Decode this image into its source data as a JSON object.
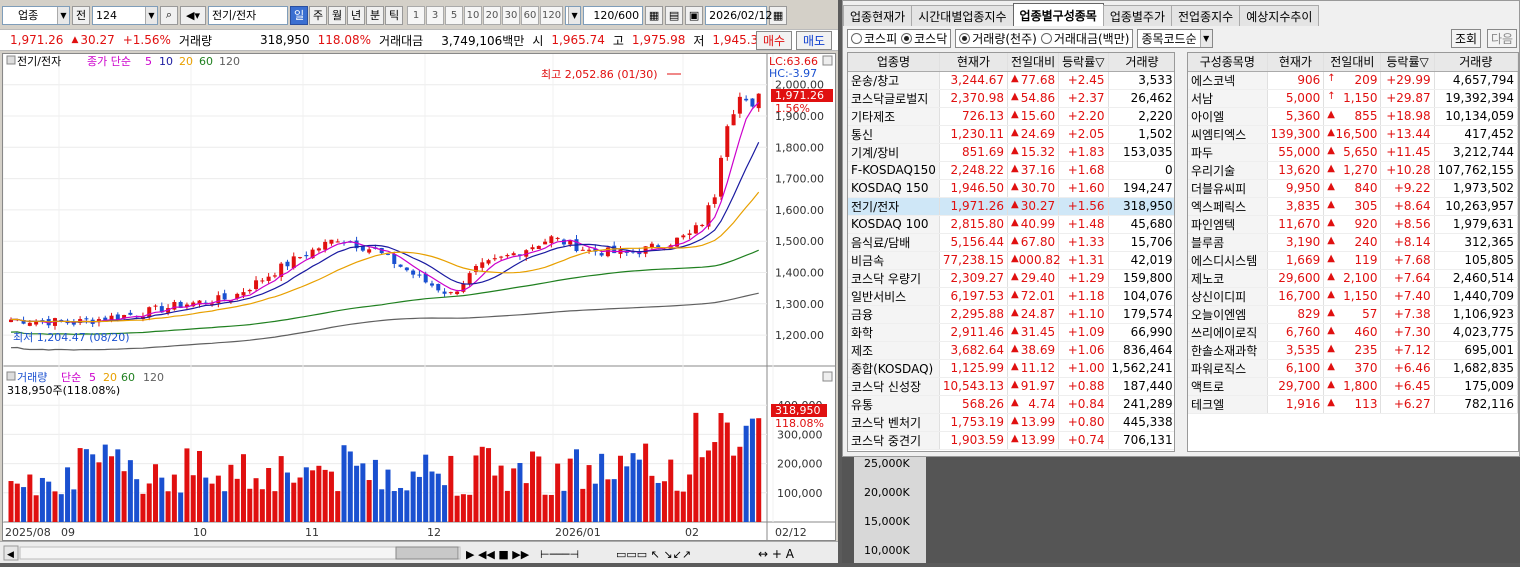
{
  "toolbar": {
    "sector_label": "업종",
    "prev_label": "전",
    "code": "124",
    "name": "전기/전자",
    "periods": [
      "일",
      "주",
      "월",
      "년",
      "분",
      "틱"
    ],
    "selected_period": "일",
    "nums": [
      "1",
      "3",
      "5",
      "10",
      "20",
      "30",
      "60",
      "120"
    ],
    "count": "120/600",
    "date": "2026/02/12"
  },
  "quote": {
    "price": "1,971.26",
    "arrow": "▲",
    "change": "30.27",
    "rate": "+1.56%",
    "vol_label": "거래량",
    "volume": "318,950",
    "vol_pct": "118.08%",
    "amt_label": "거래대금",
    "amount": "3,749,106백만",
    "open_label": "시",
    "open": "1,965.74",
    "high_label": "고",
    "high": "1,975.98",
    "low_label": "저",
    "low": "1,945.37",
    "buy": "매수",
    "sell": "매도"
  },
  "chart": {
    "legend_price": "전기/전자",
    "legend_ma_label": "종가 단순",
    "ma_periods": [
      "5",
      "10",
      "20",
      "60",
      "120"
    ],
    "lc": "LC:63.66",
    "hc": "HC:-3.97",
    "high_note": "최고 2,052.86 (01/30)",
    "low_note": "최저 1,204.47 (08/20)",
    "price_axis": [
      "2,000.00",
      "1,900.00",
      "1,800.00",
      "1,700.00",
      "1,600.00",
      "1,500.00",
      "1,400.00",
      "1,300.00",
      "1,200.00"
    ],
    "cur_price": "1,971.26",
    "cur_pct": "1.56%",
    "vol_legend": "거래량",
    "vol_ma_label": "단순",
    "vol_ma": [
      "5",
      "20",
      "60",
      "120"
    ],
    "vol_now": "318,950주(118.08%)",
    "vol_axis": [
      "400,000",
      "300,000",
      "200,000",
      "100,000"
    ],
    "vol_cur": "318,950",
    "vol_cur_pct": "118.08%",
    "x_labels": [
      "2025/08",
      "09",
      "10",
      "11",
      "12",
      "2026/01",
      "02",
      "02/12"
    ],
    "colors": {
      "up": "#e01010",
      "down": "#1a50d0",
      "ma5": "#cc00cc",
      "ma10": "#1a1aa0",
      "ma20": "#e8a000",
      "ma60": "#208020",
      "ma120": "#606060"
    }
  },
  "right": {
    "tabs": [
      "업종현재가",
      "시간대별업종지수",
      "업종별구성종목",
      "업종별주가",
      "전업종지수",
      "예상지수추이"
    ],
    "active_tab": "업종별구성종목",
    "opts": {
      "kospi": "코스피",
      "kosdaq": "코스닥",
      "vol": "거래량(천주)",
      "amt": "거래대금(백만)",
      "sort": "종목코드순",
      "query": "조회",
      "next": "다음"
    },
    "left_headers": [
      "업종명",
      "현재가",
      "전일대비",
      "등락률▽",
      "거래량"
    ],
    "left_rows": [
      [
        "운송/창고",
        "3,244.67",
        "▲",
        "77.68",
        "+2.45",
        "3,533"
      ],
      [
        "코스닥글로벌지",
        "2,370.98",
        "▲",
        "54.86",
        "+2.37",
        "26,462"
      ],
      [
        "기타제조",
        "726.13",
        "▲",
        "15.60",
        "+2.20",
        "2,220"
      ],
      [
        "통신",
        "1,230.11",
        "▲",
        "24.69",
        "+2.05",
        "1,502"
      ],
      [
        "기계/장비",
        "851.69",
        "▲",
        "15.32",
        "+1.83",
        "153,035"
      ],
      [
        "F-KOSDAQ150",
        "2,248.22",
        "▲",
        "37.16",
        "+1.68",
        "0"
      ],
      [
        "KOSDAQ 150",
        "1,946.50",
        "▲",
        "30.70",
        "+1.60",
        "194,247"
      ],
      [
        "전기/전자",
        "1,971.26",
        "▲",
        "30.27",
        "+1.56",
        "318,950"
      ],
      [
        "KOSDAQ 100",
        "2,815.80",
        "▲",
        "40.99",
        "+1.48",
        "45,680"
      ],
      [
        "음식료/담배",
        "5,156.44",
        "▲",
        "67.80",
        "+1.33",
        "15,706"
      ],
      [
        "비금속",
        "77,238.15",
        "▲",
        "000.82",
        "+1.31",
        "42,019"
      ],
      [
        "코스닥 우량기",
        "2,309.27",
        "▲",
        "29.40",
        "+1.29",
        "159,800"
      ],
      [
        "일반서비스",
        "6,197.53",
        "▲",
        "72.01",
        "+1.18",
        "104,076"
      ],
      [
        "금융",
        "2,295.88",
        "▲",
        "24.87",
        "+1.10",
        "179,574"
      ],
      [
        "화학",
        "2,911.46",
        "▲",
        "31.45",
        "+1.09",
        "66,990"
      ],
      [
        "제조",
        "3,682.64",
        "▲",
        "38.69",
        "+1.06",
        "836,464"
      ],
      [
        "종합(KOSDAQ)",
        "1,125.99",
        "▲",
        "11.12",
        "+1.00",
        "1,562,241"
      ],
      [
        "코스닥 신성장",
        "10,543.13",
        "▲",
        "91.97",
        "+0.88",
        "187,440"
      ],
      [
        "유통",
        "568.26",
        "▲",
        "4.74",
        "+0.84",
        "241,289"
      ],
      [
        "코스닥 벤처기",
        "1,753.19",
        "▲",
        "13.99",
        "+0.80",
        "445,338"
      ],
      [
        "코스닥 중견기",
        "1,903.59",
        "▲",
        "13.99",
        "+0.74",
        "706,131"
      ]
    ],
    "right_headers": [
      "구성종목명",
      "현재가",
      "전일대비",
      "등락률▽",
      "거래량"
    ],
    "right_rows": [
      [
        "에스코넥",
        "906",
        "↑",
        "209",
        "+29.99",
        "4,657,794"
      ],
      [
        "서남",
        "5,000",
        "↑",
        "1,150",
        "+29.87",
        "19,392,394"
      ],
      [
        "아이엘",
        "5,360",
        "▲",
        "855",
        "+18.98",
        "10,134,059"
      ],
      [
        "씨엠티엑스",
        "139,300",
        "▲",
        "16,500",
        "+13.44",
        "417,452"
      ],
      [
        "파두",
        "55,000",
        "▲",
        "5,650",
        "+11.45",
        "3,212,744"
      ],
      [
        "우리기술",
        "13,620",
        "▲",
        "1,270",
        "+10.28",
        "107,762,155"
      ],
      [
        "더블유씨피",
        "9,950",
        "▲",
        "840",
        "+9.22",
        "1,973,502"
      ],
      [
        "엑스페릭스",
        "3,835",
        "▲",
        "305",
        "+8.64",
        "10,263,957"
      ],
      [
        "파인엠텍",
        "11,670",
        "▲",
        "920",
        "+8.56",
        "1,979,631"
      ],
      [
        "블루콤",
        "3,190",
        "▲",
        "240",
        "+8.14",
        "312,365"
      ],
      [
        "에스디시스템",
        "1,669",
        "▲",
        "119",
        "+7.68",
        "105,805"
      ],
      [
        "제노코",
        "29,600",
        "▲",
        "2,100",
        "+7.64",
        "2,460,514"
      ],
      [
        "상신이디피",
        "16,700",
        "▲",
        "1,150",
        "+7.40",
        "1,440,709"
      ],
      [
        "오늘이엔엠",
        "829",
        "▲",
        "57",
        "+7.38",
        "1,106,923"
      ],
      [
        "쓰리에이로직",
        "6,760",
        "▲",
        "460",
        "+7.30",
        "4,023,775"
      ],
      [
        "한솔소재과학",
        "3,535",
        "▲",
        "235",
        "+7.12",
        "695,001"
      ],
      [
        "파워로직스",
        "6,100",
        "▲",
        "370",
        "+6.46",
        "1,682,835"
      ],
      [
        "액트로",
        "29,700",
        "▲",
        "1,800",
        "+6.45",
        "175,009"
      ],
      [
        "테크엘",
        "1,916",
        "▲",
        "113",
        "+6.27",
        "782,116"
      ]
    ]
  },
  "bottom_axis": [
    "25,000K",
    "20,000K",
    "15,000K",
    "10,000K"
  ]
}
